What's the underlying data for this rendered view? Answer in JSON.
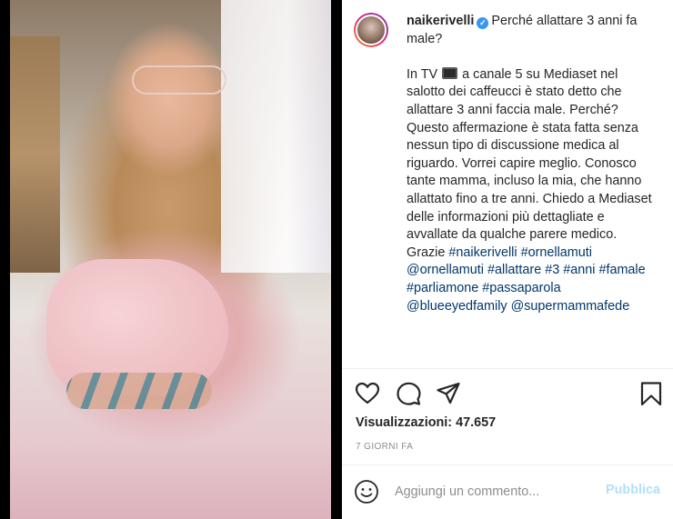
{
  "post": {
    "username": "naikerivelli",
    "title_text": "Perché allattare 3 anni fa male?",
    "caption": {
      "text_1": "In TV",
      "text_2": "a canale 5 su Mediaset nel salotto dei caffeucci è stato detto che allattare 3 anni faccia male. Perché? Questo affermazione è stata fatta senza nessun tipo di discussione medica al riguardo. Vorrei capire meglio. Conosco tante mamma, incluso la mia, che hanno allattato fino a tre anni. Chiedo a Mediaset delle informazioni più dettagliate e avvallate da qualche parere medico. Grazie",
      "tags": [
        "#naikerivelli",
        "#ornellamuti",
        "@ornellamuti",
        "#allattare",
        "#3",
        "#anni",
        "#famale",
        "#parliamone",
        "#passaparola",
        "@blueeyedfamily",
        "@supermammafede"
      ]
    },
    "icons": {
      "verified": "verified-badge-icon",
      "tv": "television-icon",
      "like": "heart-icon",
      "comment": "comment-bubble-icon",
      "share": "paper-plane-icon",
      "save": "bookmark-icon",
      "emoji": "smiley-icon"
    },
    "views_label": "Visualizzazioni: 47.657",
    "timestamp": "7 GIORNI FA"
  },
  "comment_box": {
    "placeholder": "Aggiungi un commento...",
    "publish_label": "Pubblica"
  },
  "colors": {
    "link": "#00376b",
    "verified": "#3897f0",
    "publish_disabled": "#b2dffc",
    "muted": "#8e8e8e"
  }
}
